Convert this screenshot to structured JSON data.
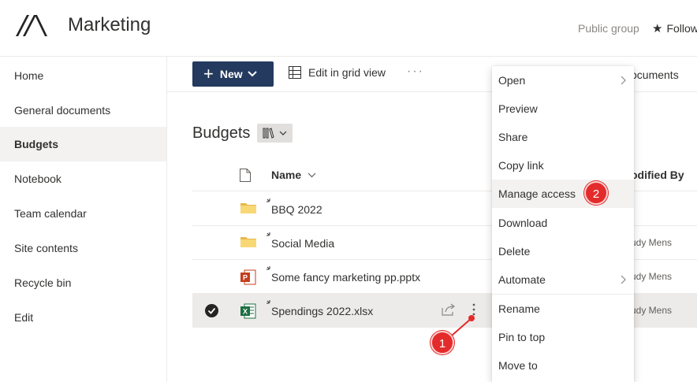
{
  "header": {
    "site_title": "Marketing",
    "public_group": "Public group",
    "follow": "Follow"
  },
  "nav": {
    "items": [
      {
        "label": "Home"
      },
      {
        "label": "General documents"
      },
      {
        "label": "Budgets",
        "selected": true
      },
      {
        "label": "Notebook"
      },
      {
        "label": "Team calendar"
      },
      {
        "label": "Site contents"
      },
      {
        "label": "Recycle bin"
      },
      {
        "label": "Edit"
      }
    ]
  },
  "commandbar": {
    "new_label": "New",
    "grid_label": "Edit in grid view",
    "more_label": "···",
    "view_label": "ocuments"
  },
  "library": {
    "title": "Budgets"
  },
  "table": {
    "name_header": "Name",
    "modified_by_header": "odified By",
    "rows": [
      {
        "name": "BBQ 2022",
        "type": "folder",
        "modified_by": ""
      },
      {
        "name": "Social Media",
        "type": "folder",
        "modified_by": "udy Mens"
      },
      {
        "name": "Some fancy marketing pp.pptx",
        "type": "pptx",
        "modified_by": "udy Mens"
      },
      {
        "name": "Spendings 2022.xlsx",
        "type": "xlsx",
        "modified_by": "udy Mens",
        "selected": true
      }
    ]
  },
  "context_menu": {
    "items": [
      {
        "label": "Open",
        "submenu": true
      },
      {
        "label": "Preview"
      },
      {
        "label": "Share"
      },
      {
        "label": "Copy link"
      },
      {
        "label": "Manage access",
        "highlighted": true
      },
      {
        "label": "Download"
      },
      {
        "label": "Delete"
      },
      {
        "label": "Automate",
        "submenu": true
      },
      {
        "label": "Rename"
      },
      {
        "label": "Pin to top"
      },
      {
        "label": "Move to"
      }
    ]
  },
  "annotations": {
    "step1": "1",
    "step2": "2"
  },
  "colors": {
    "new_button": "#243a5e",
    "annotation": "#e32b2b",
    "folder": "#f8d775",
    "excel": "#1d6f42",
    "powerpoint": "#c43e1c"
  }
}
